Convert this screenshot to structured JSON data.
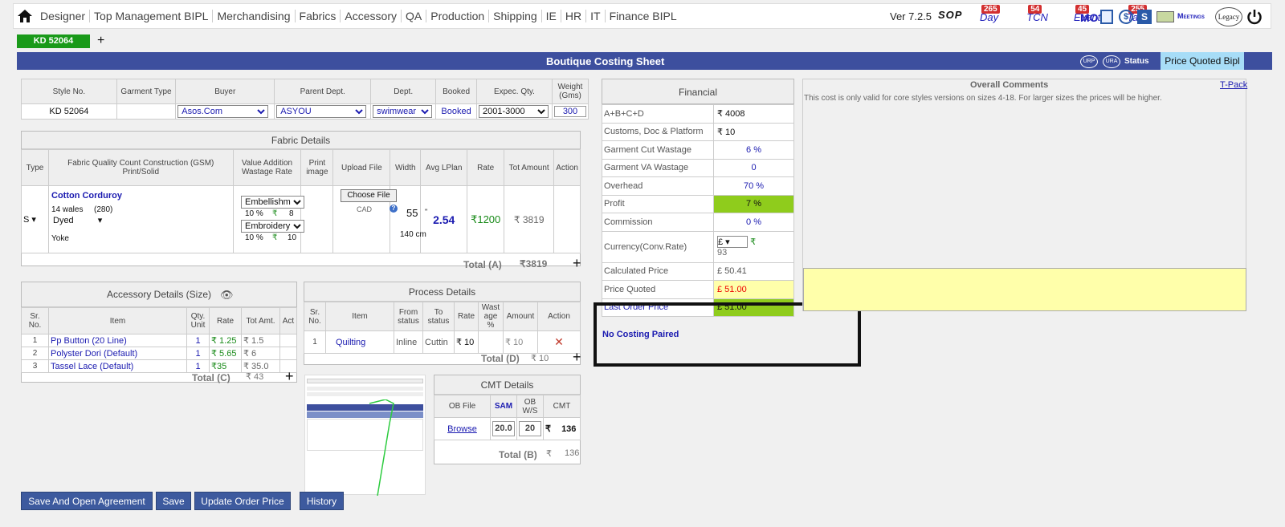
{
  "nav": {
    "items": [
      "Designer",
      "Top Management BIPL",
      "Merchandising",
      "Fabrics",
      "Accessory",
      "QA",
      "Production",
      "Shipping",
      "IE",
      "HR",
      "IT",
      "Finance BIPL"
    ],
    "version": "Ver 7.2.5",
    "sop": "SOP",
    "badges": [
      {
        "label": "Day",
        "count": "265"
      },
      {
        "label": "TCN",
        "count": "54"
      },
      {
        "label": "Event",
        "count": "45"
      },
      {
        "label": "Task",
        "count": "255"
      }
    ],
    "mo": "MO",
    "meetings": "Meetings",
    "legacy": "Legacy"
  },
  "style_tab": "KD 52064",
  "add_tab": "+",
  "banner": {
    "title": "Boutique Costing Sheet",
    "ur1": "URP",
    "ur2": "URA",
    "status_label": "Status",
    "status_value": "Price Quoted Bipl"
  },
  "header": {
    "cols": [
      "Style No.",
      "Garment Type",
      "Buyer",
      "Parent Dept.",
      "Dept.",
      "Booked",
      "Expec. Qty.",
      "Weight (Gms)"
    ],
    "style_no": "KD 52064",
    "garment_type": "",
    "buyer": "Asos.Com",
    "parent": "ASYOU",
    "dept": "swimwear",
    "booked": "Booked",
    "qty": "2001-3000",
    "weight": "300"
  },
  "fabric": {
    "title": "Fabric Details",
    "cols": [
      "Type",
      "Fabric Quality Count Construction (GSM) Print/Solid",
      "Value Addition Wastage Rate",
      "Print image",
      "Upload File",
      "Width",
      "Avg LPlan",
      "Rate",
      "Tot Amount",
      "Action"
    ],
    "type": "S",
    "quality": "Cotton Corduroy",
    "construction": "14 wales",
    "gsm": "(280)",
    "finish": "Dyed",
    "part": "Yoke",
    "va1": "Embellishm",
    "va1_pct": "10 %",
    "va1_rate": "8",
    "va2": "Embroidery",
    "va2_pct": "10 %",
    "va2_rate": "10",
    "choose": "Choose File",
    "cad": "CAD",
    "width": "55",
    "width_unit": "\"",
    "width_cm": "140 cm",
    "lplan": "2.54",
    "rate": "₹1200",
    "amount": "₹ 3819",
    "total_label": "Total (A)",
    "total": "₹3819"
  },
  "accessory": {
    "title": "Accessory Details (Size)",
    "cols": [
      "Sr. No.",
      "Item",
      "Qty. Unit",
      "Rate",
      "Tot Amt.",
      "Act"
    ],
    "rows": [
      {
        "sr": "1",
        "item": "Pp Button (20 Line)",
        "qty": "1",
        "rate": "₹ 1.25",
        "amt": "₹ 1.5"
      },
      {
        "sr": "2",
        "item": "Polyster Dori (Default)",
        "qty": "1",
        "rate": "₹ 5.65",
        "amt": "₹ 6"
      },
      {
        "sr": "3",
        "item": "Tassel Lace (Default)",
        "qty": "1",
        "rate": "₹35",
        "amt": "₹ 35.0"
      }
    ],
    "total_label": "Total (C)",
    "total": "₹ 43"
  },
  "process": {
    "title": "Process Details",
    "cols": [
      "Sr. No.",
      "Item",
      "From status",
      "To status",
      "Rate",
      "Wast age %",
      "Amount",
      "Action"
    ],
    "rows": [
      {
        "sr": "1",
        "item": "Quilting",
        "from": "Inline",
        "to": "Cuttin",
        "rate": "₹ 10",
        "waste": "",
        "amount": "₹ 10"
      }
    ],
    "total_label": "Total (D)",
    "total": "₹ 10"
  },
  "cmt": {
    "title": "CMT Details",
    "cols": [
      "OB File",
      "SAM",
      "OB W/S",
      "CMT"
    ],
    "browse": "Browse",
    "sam": "20.0",
    "ws": "20",
    "cmt": "136",
    "total_label": "Total (B)",
    "total": "136"
  },
  "financial": {
    "title": "Financial",
    "rows": [
      {
        "label": "A+B+C+D",
        "value": "₹ 4008"
      },
      {
        "label": "Customs, Doc & Platform",
        "value": "₹ 10"
      },
      {
        "label": "Garment Cut Wastage",
        "value": "6 %"
      },
      {
        "label": "Garment VA Wastage",
        "value": "0"
      },
      {
        "label": "Overhead",
        "value": "70 %"
      },
      {
        "label": "Profit",
        "value": "7 %"
      },
      {
        "label": "Commission",
        "value": "0 %"
      }
    ],
    "currency_label": "Currency(Conv.Rate)",
    "currency": "£",
    "rupee": "₹",
    "rate": "93",
    "calc_label": "Calculated Price",
    "calc": "£ 50.41",
    "quoted_label": "Price Quoted",
    "quoted": "£ 51.00",
    "last_label": "Last Order Price",
    "last": "£ 51.00",
    "paired": "No Costing Paired"
  },
  "comments": {
    "title": "Overall Comments",
    "tpack": "T-Pack",
    "text": "This cost is only valid for core styles versions on sizes 4-18. For larger sizes the prices will be higher."
  },
  "buttons": {
    "save_open": "Save And Open Agreement",
    "save": "Save",
    "update": "Update Order Price",
    "history": "History"
  },
  "colors": {
    "banner": "#3d4f9e",
    "green": "#8fcc1c",
    "yellow": "#ffffaa",
    "tab": "#1a9a1a"
  }
}
